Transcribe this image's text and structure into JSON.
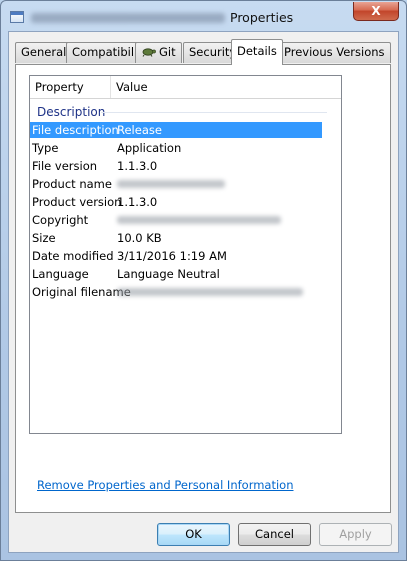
{
  "window": {
    "title": "Properties",
    "close_label": "X"
  },
  "tabs": [
    {
      "label": "General"
    },
    {
      "label": "Compatibility"
    },
    {
      "label": "Git"
    },
    {
      "label": "Security"
    },
    {
      "label": "Details",
      "active": true
    },
    {
      "label": "Previous Versions"
    }
  ],
  "details": {
    "columns": {
      "property": "Property",
      "value": "Value"
    },
    "group": "Description",
    "rows": [
      {
        "property": "File description",
        "value": "Release",
        "selected": true
      },
      {
        "property": "Type",
        "value": "Application"
      },
      {
        "property": "File version",
        "value": "1.1.3.0"
      },
      {
        "property": "Product name",
        "value": ""
      },
      {
        "property": "Product version",
        "value": "1.1.3.0"
      },
      {
        "property": "Copyright",
        "value": ""
      },
      {
        "property": "Size",
        "value": "10.0 KB"
      },
      {
        "property": "Date modified",
        "value": "3/11/2016 1:19 AM"
      },
      {
        "property": "Language",
        "value": "Language Neutral"
      },
      {
        "property": "Original filename",
        "value": ""
      }
    ],
    "remove_link": "Remove Properties and Personal Information"
  },
  "buttons": {
    "ok": "OK",
    "cancel": "Cancel",
    "apply": "Apply"
  },
  "colors": {
    "selection": "#3399ff",
    "link": "#0066cc",
    "group_header": "#1e3287"
  }
}
